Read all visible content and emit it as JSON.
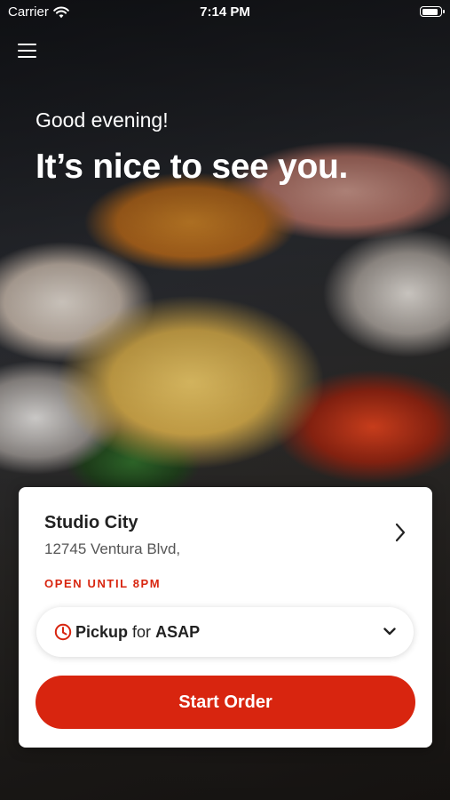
{
  "status_bar": {
    "carrier": "Carrier",
    "time": "7:14 PM",
    "wifi_icon": "wifi-icon",
    "battery_icon": "battery-icon"
  },
  "nav": {
    "menu_icon": "hamburger-menu-icon"
  },
  "hero": {
    "greeting": "Good evening!",
    "headline": "It’s nice to see you."
  },
  "location": {
    "name": "Studio City",
    "address": "12745 Ventura Blvd,",
    "status": "OPEN UNTIL 8PM",
    "chevron_icon": "chevron-right-icon"
  },
  "order_mode": {
    "clock_icon": "clock-icon",
    "mode": "Pickup",
    "connector": "for",
    "time": "ASAP",
    "chevron_icon": "chevron-down-icon"
  },
  "actions": {
    "start_order_label": "Start Order"
  },
  "colors": {
    "accent": "#d8250f",
    "text_dark": "#222222",
    "text_muted": "#555555"
  }
}
